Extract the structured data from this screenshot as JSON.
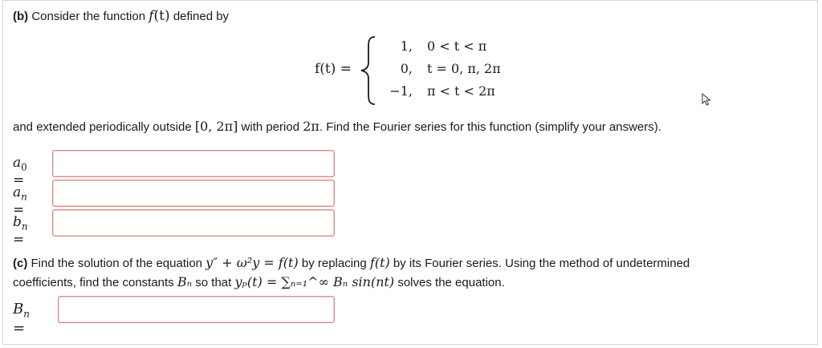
{
  "part_b": {
    "label": "(b)",
    "intro": " Consider the function ",
    "fname": "f",
    "fvar": "(t)",
    "after": " defined by",
    "def_lhs": "f(t) =",
    "cases": [
      {
        "value": "1,",
        "cond": "0 < t < π"
      },
      {
        "value": "0,",
        "cond": "t = 0, π, 2π"
      },
      {
        "value": "−1,",
        "cond": "π < t < 2π"
      }
    ],
    "sentence_1": "and extended periodically outside ",
    "interval": "[0, 2π]",
    "sentence_2": " with period ",
    "period": "2π",
    "sentence_3": ". Find the Fourier series for this function (simplify your answers).",
    "answers": [
      {
        "label_base": "a",
        "label_sub": "0",
        "eq": " =",
        "value": ""
      },
      {
        "label_base": "a",
        "label_sub": "n",
        "eq": " =",
        "value": ""
      },
      {
        "label_base": "b",
        "label_sub": "n",
        "eq": " =",
        "value": ""
      }
    ]
  },
  "part_c": {
    "label": "(c)",
    "text_1": " Find the solution of the equation ",
    "equation": "y″ + ω²y = f(t)",
    "text_2": " by replacing ",
    "ft": "f(t)",
    "text_3": " by its Fourier series. Using the method of undetermined",
    "text_4": "coefficients, find the constants ",
    "Bn": "Bₙ",
    "text_5": " so that ",
    "sum": "yₚ(t) = ∑ₙ₌₁^∞ Bₙ sin(nt)",
    "text_6": " solves the equation.",
    "answer": {
      "label_base": "B",
      "label_sub": "n",
      "eq": " =",
      "value": ""
    }
  }
}
